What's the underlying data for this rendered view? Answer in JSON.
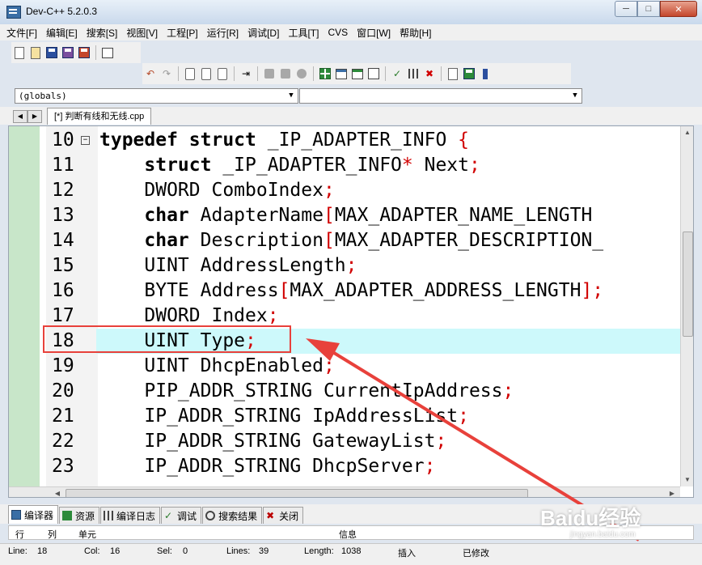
{
  "window": {
    "title": "Dev-C++ 5.2.0.3"
  },
  "menu": [
    "文件[F]",
    "编辑[E]",
    "搜索[S]",
    "视图[V]",
    "工程[P]",
    "运行[R]",
    "调试[D]",
    "工具[T]",
    "CVS",
    "窗口[W]",
    "帮助[H]"
  ],
  "scope_combo": {
    "value": "(globals)"
  },
  "member_combo": {
    "value": ""
  },
  "file_tab": {
    "label": "[*] 判断有线和无线.cpp"
  },
  "code_lines": [
    {
      "no": "10",
      "tokens": [
        [
          "kw",
          "typedef"
        ],
        [
          "id",
          " "
        ],
        [
          "kw",
          "struct"
        ],
        [
          "id",
          " _IP_ADAPTER_INFO "
        ],
        [
          "op",
          "{"
        ]
      ]
    },
    {
      "no": "11",
      "tokens": [
        [
          "id",
          "    "
        ],
        [
          "kw",
          "struct"
        ],
        [
          "id",
          " _IP_ADAPTER_INFO"
        ],
        [
          "op",
          "*"
        ],
        [
          "id",
          " Next"
        ],
        [
          "op",
          ";"
        ]
      ]
    },
    {
      "no": "12",
      "tokens": [
        [
          "id",
          "    DWORD ComboIndex"
        ],
        [
          "op",
          ";"
        ]
      ]
    },
    {
      "no": "13",
      "tokens": [
        [
          "id",
          "    "
        ],
        [
          "kw",
          "char"
        ],
        [
          "id",
          " AdapterName"
        ],
        [
          "op",
          "["
        ],
        [
          "id",
          "MAX_ADAPTER_NAME_LENGTH "
        ]
      ]
    },
    {
      "no": "14",
      "tokens": [
        [
          "id",
          "    "
        ],
        [
          "kw",
          "char"
        ],
        [
          "id",
          " Description"
        ],
        [
          "op",
          "["
        ],
        [
          "id",
          "MAX_ADAPTER_DESCRIPTION_"
        ]
      ]
    },
    {
      "no": "15",
      "tokens": [
        [
          "id",
          "    UINT AddressLength"
        ],
        [
          "op",
          ";"
        ]
      ]
    },
    {
      "no": "16",
      "tokens": [
        [
          "id",
          "    BYTE Address"
        ],
        [
          "op",
          "["
        ],
        [
          "id",
          "MAX_ADAPTER_ADDRESS_LENGTH"
        ],
        [
          "op",
          "];"
        ]
      ]
    },
    {
      "no": "17",
      "tokens": [
        [
          "id",
          "    DWORD Index"
        ],
        [
          "op",
          ";"
        ]
      ]
    },
    {
      "no": "18",
      "tokens": [
        [
          "id",
          "    UINT Type"
        ],
        [
          "op",
          ";"
        ]
      ]
    },
    {
      "no": "19",
      "tokens": [
        [
          "id",
          "    UINT DhcpEnabled"
        ],
        [
          "op",
          ";"
        ]
      ]
    },
    {
      "no": "20",
      "tokens": [
        [
          "id",
          "    PIP_ADDR_STRING CurrentIpAddress"
        ],
        [
          "op",
          ";"
        ]
      ]
    },
    {
      "no": "21",
      "tokens": [
        [
          "id",
          "    IP_ADDR_STRING IpAddressList"
        ],
        [
          "op",
          ";"
        ]
      ]
    },
    {
      "no": "22",
      "tokens": [
        [
          "id",
          "    IP_ADDR_STRING GatewayList"
        ],
        [
          "op",
          ";"
        ]
      ]
    },
    {
      "no": "23",
      "tokens": [
        [
          "id",
          "    IP_ADDR_STRING DhcpServer"
        ],
        [
          "op",
          ";"
        ]
      ]
    }
  ],
  "highlighted_line": "18",
  "bottom_tabs": [
    {
      "label": "编译器",
      "icon": "compiler-icon"
    },
    {
      "label": "资源",
      "icon": "resources-icon"
    },
    {
      "label": "编译日志",
      "icon": "compile-log-icon"
    },
    {
      "label": "调试",
      "icon": "debug-icon"
    },
    {
      "label": "搜索结果",
      "icon": "search-results-icon"
    },
    {
      "label": "关闭",
      "icon": "close-icon"
    }
  ],
  "message_columns": {
    "row": "行",
    "col": "列",
    "unit": "单元",
    "info": "信息"
  },
  "status": {
    "line_label": "Line:",
    "line": "18",
    "col_label": "Col:",
    "col": "16",
    "sel_label": "Sel:",
    "sel": "0",
    "lines_label": "Lines:",
    "lines": "39",
    "length_label": "Length:",
    "length": "1038",
    "mode": "插入",
    "modified": "已修改"
  },
  "watermark": {
    "brand": "Baidu经验",
    "url": "jingyan.baidu.com"
  },
  "colors": {
    "highlight": "#cdf9fb",
    "annotation": "#e8413b",
    "operator": "#d10000"
  }
}
